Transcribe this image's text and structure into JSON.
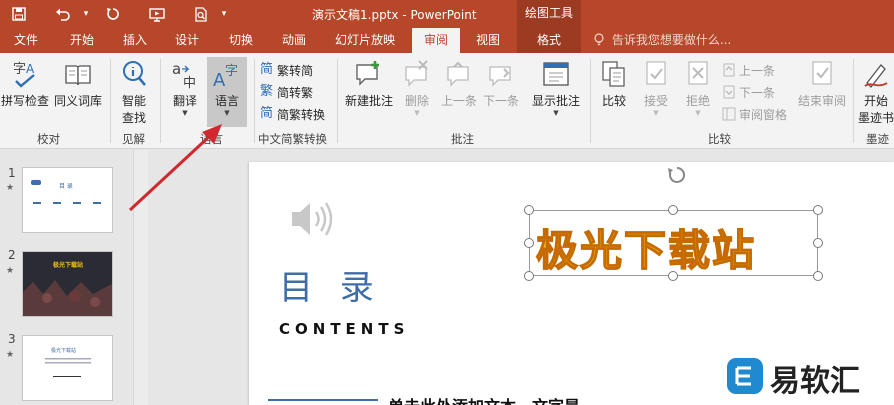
{
  "titlebar": {
    "document_title": "演示文稿1.pptx - PowerPoint",
    "context_group": "绘图工具"
  },
  "tabs": {
    "file": "文件",
    "home": "开始",
    "insert": "插入",
    "design": "设计",
    "transitions": "切换",
    "animations": "动画",
    "slideshow": "幻灯片放映",
    "review": "审阅",
    "view": "视图",
    "format": "格式",
    "tellme": "告诉我您想要做什么..."
  },
  "ribbon": {
    "proofing": {
      "spell": "拼写检查",
      "thesaurus": "同义词库",
      "label": "校对"
    },
    "insights": {
      "smart_lookup_line1": "智能",
      "smart_lookup_line2": "查找",
      "label": "见解"
    },
    "language": {
      "translate": "翻译",
      "language": "语言",
      "label": "语言"
    },
    "chinese_conversion": {
      "trad_to_simp": "繁转简",
      "simp_to_trad": "简转繁",
      "convert": "简繁转换",
      "label": "中文简繁转换"
    },
    "comments": {
      "new_comment": "新建批注",
      "delete": "删除",
      "previous": "上一条",
      "next": "下一条",
      "show_comments": "显示批注",
      "label": "批注"
    },
    "compare": {
      "compare": "比较",
      "accept": "接受",
      "reject": "拒绝",
      "prev_change": "上一条",
      "next_change": "下一条",
      "reviewing_pane": "审阅窗格",
      "end_review": "结束审阅",
      "label": "比较"
    },
    "ink": {
      "start_inking_line1": "开始",
      "start_inking_line2": "墨迹书",
      "label": "墨迹"
    }
  },
  "thumbnails": {
    "slide1": {
      "number": "1",
      "star": "★",
      "title": "目  录"
    },
    "slide2": {
      "number": "2",
      "star": "★",
      "title": "极光下载站"
    },
    "slide3": {
      "number": "3",
      "star": "★",
      "title": "极光下载站"
    }
  },
  "slide": {
    "title": "目 录",
    "contents": "CONTENTS",
    "wordart": "极光下载站",
    "footer_text": "单击此处添加文本，文字是"
  },
  "watermark": {
    "text": "易软汇"
  },
  "colors": {
    "brand": "#b7472a",
    "title_blue": "#3e6da8",
    "wordart_fill": "#f5c21a",
    "arrow": "#d0282e"
  }
}
